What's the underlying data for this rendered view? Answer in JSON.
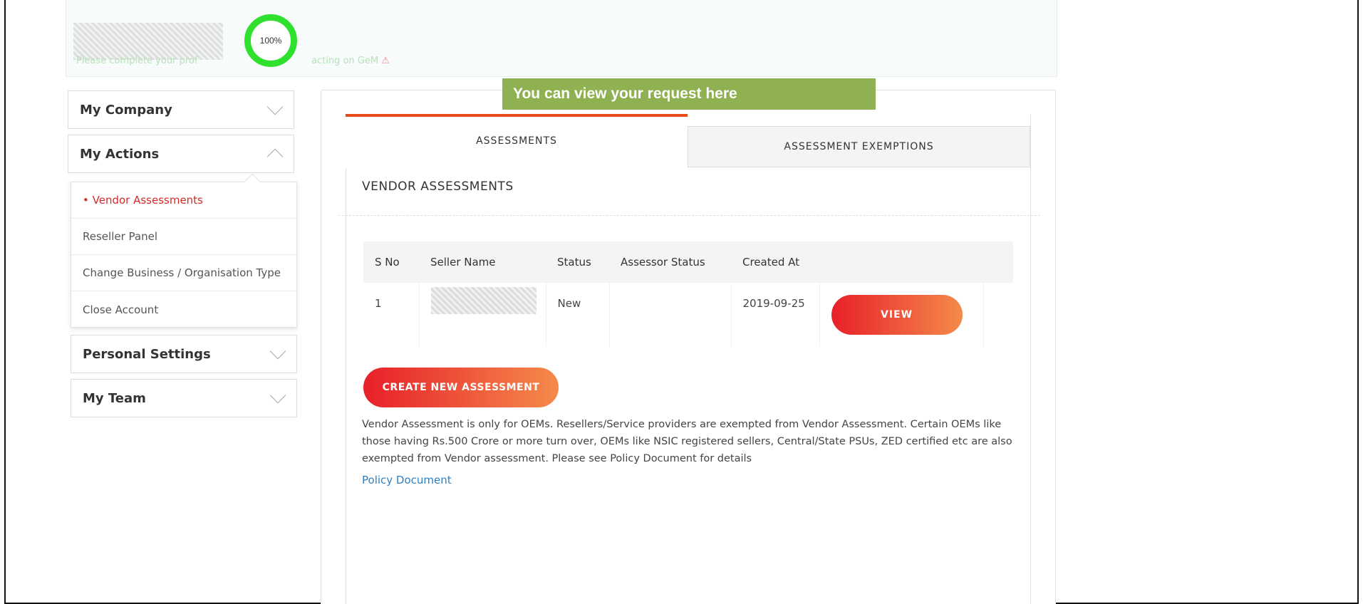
{
  "profile": {
    "completion": "100%",
    "note_left": "Please complete your prof",
    "note_right": "acting on GeM",
    "warning_glyph": "⚠"
  },
  "callout": "You can view your request here",
  "sidebar": {
    "sections": [
      {
        "label": "My Company",
        "expanded": false
      },
      {
        "label": "My Actions",
        "expanded": true
      },
      {
        "label": "Personal Settings",
        "expanded": false
      },
      {
        "label": "My Team",
        "expanded": false
      }
    ],
    "actions_items": [
      {
        "label": "• Vendor Assessments",
        "active": true
      },
      {
        "label": "Reseller Panel",
        "active": false
      },
      {
        "label": "Change Business / Organisation Type",
        "active": false
      },
      {
        "label": "Close Account",
        "active": false
      }
    ]
  },
  "tabs": [
    {
      "label": "ASSESSMENTS",
      "active": true
    },
    {
      "label": "ASSESSMENT EXEMPTIONS",
      "active": false
    }
  ],
  "section_title": "VENDOR ASSESSMENTS",
  "table": {
    "headers": [
      "S No",
      "Seller Name",
      "Status",
      "Assessor Status",
      "Created At",
      ""
    ],
    "rows": [
      {
        "sno": "1",
        "seller": "",
        "status": "New",
        "assessor_status": "",
        "created_at": "2019-09-25",
        "action": "VIEW"
      }
    ]
  },
  "create_button": "CREATE NEW ASSESSMENT",
  "notice": "Vendor Assessment is only for OEMs. Resellers/Service providers are exempted from Vendor Assessment. Certain OEMs like those having Rs.500 Crore or more turn over, OEMs like NSIC registered sellers, Central/State PSUs, ZED certified etc are also exempted from Vendor assessment. Please see Policy Document for details",
  "policy_link": "Policy Document",
  "colors": {
    "accent": "#e64a19",
    "button_start": "#e8202a",
    "button_end": "#f48a4a",
    "callout": "#8fb152",
    "progress": "#2fe02f",
    "link": "#2f7fc0",
    "active_item": "#d42a2a"
  },
  "icons": {
    "collapsed": "chevron-down-icon",
    "expanded": "chevron-up-icon",
    "warning": "warning-icon"
  }
}
